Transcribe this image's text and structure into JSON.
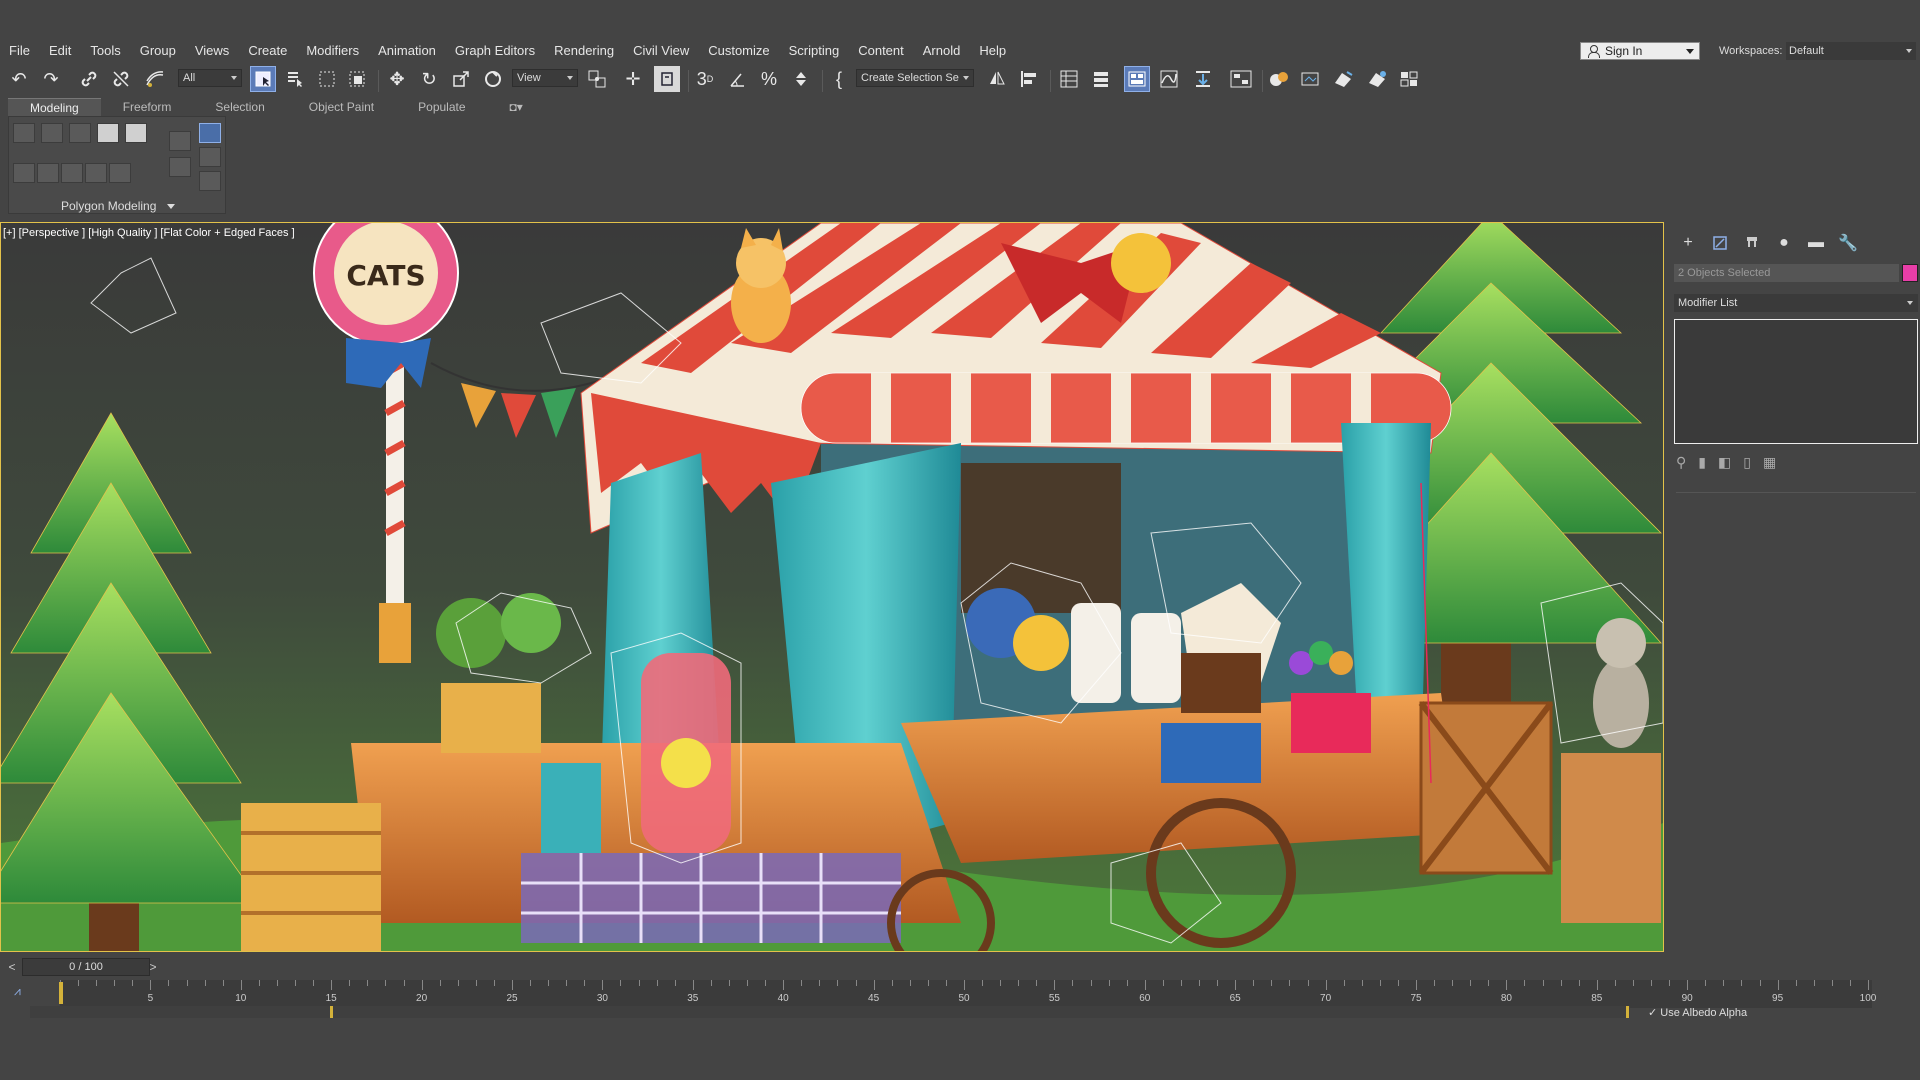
{
  "menubar": {
    "items": [
      "File",
      "Edit",
      "Tools",
      "Group",
      "Views",
      "Create",
      "Modifiers",
      "Animation",
      "Graph Editors",
      "Rendering",
      "Civil View",
      "Customize",
      "Scripting",
      "Content",
      "Arnold",
      "Help"
    ],
    "sign_in": "Sign In",
    "workspaces_label": "Workspaces:",
    "workspaces_value": "Default"
  },
  "toolbar": {
    "filter_value": "All",
    "coord_value": "View",
    "selection_set": "Create Selection Se"
  },
  "ribbon": {
    "tabs": [
      "Modeling",
      "Freeform",
      "Selection",
      "Object Paint",
      "Populate"
    ],
    "active_tab": "Modeling",
    "panel_label": "Polygon Modeling"
  },
  "viewport": {
    "label": "[+] [Perspective ] [High Quality ] [Flat Color + Edged Faces ]",
    "sign_text": "CATS"
  },
  "command_panel": {
    "selection_text": "2 Objects Selected",
    "selection_color": "#e83ea8",
    "modifier_list": "Modifier List"
  },
  "timeline": {
    "frame_display": "0 / 100",
    "ticks": [
      "5",
      "10",
      "15",
      "20",
      "25",
      "30",
      "35",
      "40",
      "45",
      "50",
      "55",
      "60",
      "65",
      "70",
      "75",
      "80",
      "85",
      "90",
      "95",
      "100"
    ],
    "albedo_label": "Use Albedo Alpha"
  },
  "icons": [
    "undo-icon",
    "redo-icon",
    "link-icon",
    "unlink-icon",
    "bind-space-warp-icon",
    "select-object-icon",
    "select-by-name-icon",
    "rect-region-icon",
    "window-crossing-icon",
    "move-icon",
    "rotate-icon",
    "scale-icon",
    "selection-center-icon",
    "snap-icon",
    "angle-snap-icon",
    "percent-snap-icon",
    "spinner-snap-icon",
    "mirror-icon",
    "align-icon",
    "scene-explorer-icon",
    "layer-explorer-icon",
    "curve-editor-icon",
    "schematic-icon",
    "material-editor-icon",
    "render-setup-icon",
    "render-frame-icon",
    "render-icon"
  ]
}
